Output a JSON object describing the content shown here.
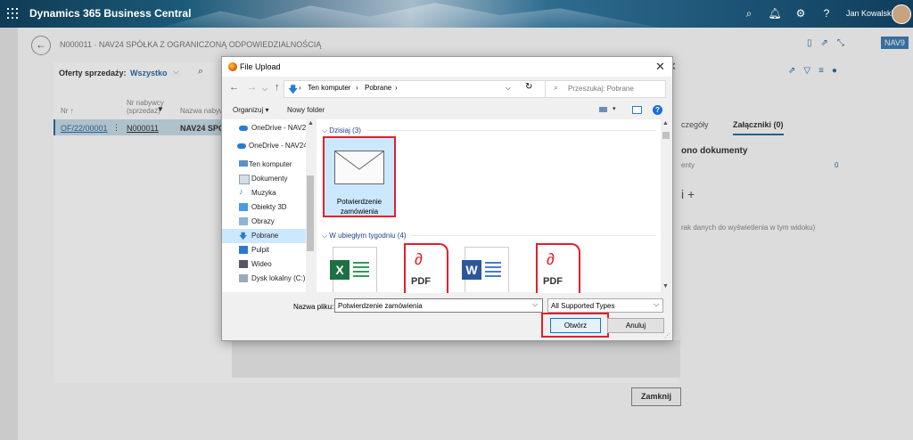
{
  "topbar": {
    "app_title": "Dynamics 365 Business Central",
    "user": "Jan Kowalski",
    "icons": [
      "search-icon",
      "bell-icon",
      "gear-icon",
      "help-icon"
    ]
  },
  "record": {
    "title": "N000011 · NAV24 SPÓŁKA Z OGRANICZONĄ ODPOWIEDZIALNOŚCIĄ",
    "badge": "NAV9"
  },
  "list": {
    "filter_label": "Oferty sprzedaży:",
    "filter_value": "Wszystko",
    "col_no": "Nr ↑",
    "col_cust_no_1": "Nr nabywcy",
    "col_cust_no_2": "(sprzedaż)",
    "col_name": "Nazwa nabyw",
    "row_no": "OF/22/00001",
    "row_cust": "N000011",
    "row_name": "NAV24 SPÓ"
  },
  "factbox": {
    "tab_details": "czegóły",
    "tab_attachments": "Załączniki (0)",
    "heading": "ono dokumenty",
    "row_label": "enty",
    "row_value": "0",
    "empty": "rak danych do wyświetlenia w tym widoku)"
  },
  "close_button": "Zamknij",
  "dialog": {
    "title": "File Upload",
    "breadcrumb": [
      "Ten komputer",
      "Pobrane"
    ],
    "search_placeholder": "Przeszukaj: Pobrane",
    "organize": "Organizuj ▾",
    "new_folder": "Nowy folder",
    "nav_items": [
      {
        "label": "OneDrive - NAV24",
        "icon": "cloud-icon"
      },
      {
        "label": "OneDrive - NAV24",
        "icon": "cloud-icon"
      },
      {
        "label": "Ten komputer",
        "icon": "computer-icon"
      },
      {
        "label": "Dokumenty",
        "icon": "documents-icon"
      },
      {
        "label": "Muzyka",
        "icon": "music-icon"
      },
      {
        "label": "Obiekty 3D",
        "icon": "objects-3d-icon"
      },
      {
        "label": "Obrazy",
        "icon": "pictures-icon"
      },
      {
        "label": "Pobrane",
        "icon": "download-icon"
      },
      {
        "label": "Pulpit",
        "icon": "desktop-icon"
      },
      {
        "label": "Wideo",
        "icon": "video-icon"
      },
      {
        "label": "Dysk lokalny (C:)",
        "icon": "drive-icon"
      }
    ],
    "group_today": "Dzisiaj (3)",
    "group_last_week": "W ubiegłym tygodniu (4)",
    "selected_file_line1": "Potwierdzenie",
    "selected_file_line2": "zamówienia",
    "files_last_week": [
      {
        "type": "excel",
        "icon": "excel-file-icon",
        "letter": "X"
      },
      {
        "type": "pdf",
        "icon": "pdf-file-icon",
        "label": "PDF"
      },
      {
        "type": "word",
        "icon": "word-file-icon",
        "letter": "W"
      },
      {
        "type": "pdf",
        "icon": "pdf-file-icon",
        "label": "PDF"
      }
    ],
    "filename_label": "Nazwa pliku:",
    "filename_value": "Potwierdzenie zamówienia",
    "filetype_value": "All Supported Types",
    "open_button": "Otwórz",
    "cancel_button": "Anuluj"
  }
}
